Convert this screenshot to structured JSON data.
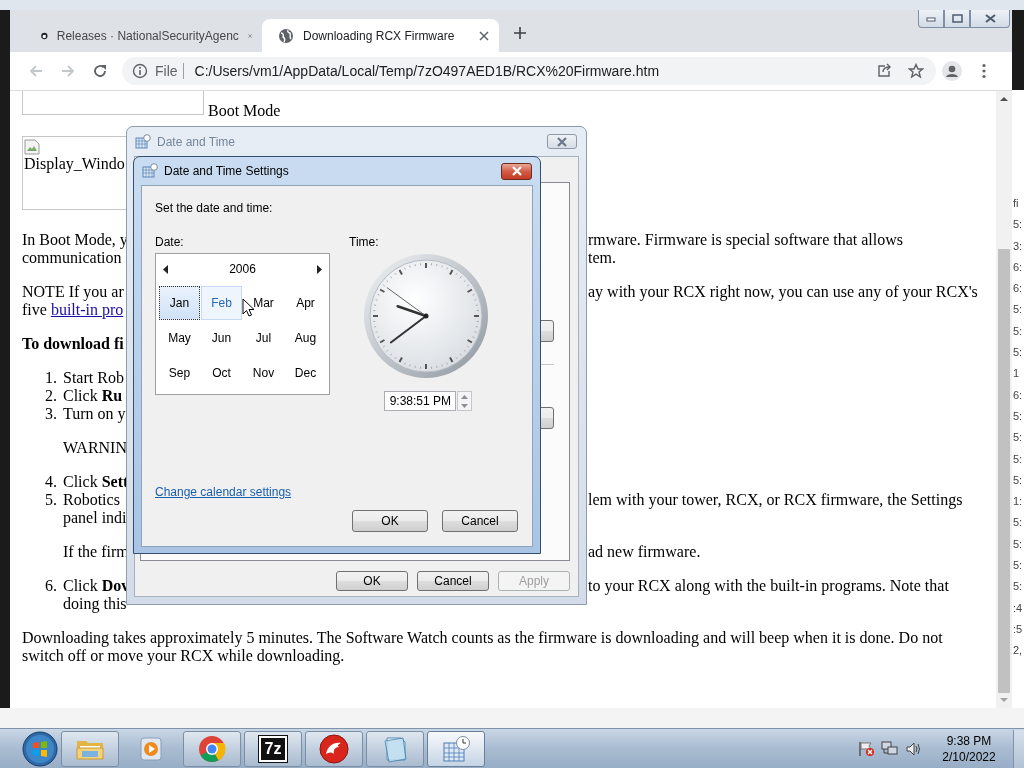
{
  "browser": {
    "tabs": [
      {
        "title": "Releases · NationalSecurityAgenc",
        "kind": "repository",
        "selected": false
      },
      {
        "title": "Downloading RCX Firmware",
        "kind": "local-page",
        "selected": true
      }
    ],
    "back": {
      "disabled": true
    },
    "forward": {
      "disabled": true
    },
    "address": {
      "scheme": "File",
      "url": "C:/Users/vm1/AppData/Local/Temp/7zO497AED1B/RCX%20Firmware.htm"
    }
  },
  "page": {
    "blocks": [
      {
        "kind": "figure",
        "caption": "Boot Mode"
      },
      {
        "kind": "broken-image",
        "alt": "Display_Windo"
      },
      {
        "kind": "paragraph",
        "lines": [
          {
            "left": "In Boot Mode, y",
            "right": "rmware. Firmware is special software that allows"
          },
          {
            "left": "communication",
            "right": "tem."
          }
        ]
      },
      {
        "kind": "paragraph",
        "lines": [
          {
            "left": "NOTE If you ar",
            "right": "ay with your RCX right now, you can use any of your RCX's"
          },
          {
            "left": "five ",
            "link": "built-in pro"
          }
        ]
      },
      {
        "kind": "heading",
        "text": "To download fi"
      },
      {
        "kind": "list",
        "items": [
          {
            "number": "1.",
            "lines": [
              {
                "left": "Start Rob"
              }
            ]
          },
          {
            "number": "2.",
            "lines": [
              {
                "left": "Click **Ru**"
              }
            ]
          },
          {
            "number": "3.",
            "lines": [
              {
                "left": "Turn on y"
              }
            ],
            "note": [
              {
                "left": "WARNIN"
              }
            ]
          },
          {
            "number": "4.",
            "lines": [
              {
                "left": "Click **Sett**"
              }
            ]
          },
          {
            "number": "5.",
            "lines": [
              {
                "left": "Robotics",
                "right": "lem with your tower, RCX, or RCX firmware, the Settings"
              },
              {
                "left": "panel indi"
              }
            ],
            "note": [
              {
                "left": "If the firm",
                "right": "ad new firmware."
              }
            ]
          },
          {
            "number": "6.",
            "lines": [
              {
                "left": "Click **Dov**",
                "right": "to your RCX along with the built-in programs. Note that"
              },
              {
                "left": "doing this"
              }
            ]
          }
        ]
      },
      {
        "kind": "paragraph",
        "lines": [
          {
            "text": "Downloading takes approximately 5 minutes. The Software Watch counts as the firmware is downloading and will beep when it is done. Do not"
          },
          {
            "text": "switch off or move your RCX while downloading."
          }
        ]
      }
    ]
  },
  "background_window": {
    "cells": [
      "fi",
      "5:",
      "3:",
      "6:",
      "6:",
      "5:",
      "5:",
      "5:",
      "1",
      "6:",
      "5:",
      "5:",
      "5:",
      "5:",
      "1:",
      "5:",
      "5:",
      "5:",
      "5:",
      ":4",
      ":5",
      "2,"
    ]
  },
  "date_time_dialog": {
    "title": "Date and Time",
    "active": false,
    "buttons": [
      {
        "label": "OK",
        "disabled": false
      },
      {
        "label": "Cancel",
        "disabled": false
      },
      {
        "label": "Apply",
        "disabled": true
      }
    ]
  },
  "settings_dialog": {
    "title": "Date and Time Settings",
    "active": true,
    "prompt": "Set the date and time:",
    "date_label": "Date:",
    "year": "2006",
    "months": [
      {
        "label": "Jan",
        "selected": true,
        "hovered": false
      },
      {
        "label": "Feb",
        "selected": false,
        "hovered": true
      },
      {
        "label": "Mar",
        "selected": false,
        "hovered": false
      },
      {
        "label": "Apr",
        "selected": false,
        "hovered": false
      },
      {
        "label": "May",
        "selected": false,
        "hovered": false
      },
      {
        "label": "Jun",
        "selected": false,
        "hovered": false
      },
      {
        "label": "Jul",
        "selected": false,
        "hovered": false
      },
      {
        "label": "Aug",
        "selected": false,
        "hovered": false
      },
      {
        "label": "Sep",
        "selected": false,
        "hovered": false
      },
      {
        "label": "Oct",
        "selected": false,
        "hovered": false
      },
      {
        "label": "Nov",
        "selected": false,
        "hovered": false
      },
      {
        "label": "Dec",
        "selected": false,
        "hovered": false
      }
    ],
    "time_label": "Time:",
    "time": "9:38:51 PM",
    "link": "Change calendar settings",
    "buttons": [
      "OK",
      "Cancel"
    ]
  },
  "taskbar": {
    "items": [
      {
        "kind": "folder",
        "running": true,
        "active": false
      },
      {
        "kind": "media",
        "running": false,
        "active": false
      },
      {
        "kind": "chrome",
        "running": true,
        "active": false
      },
      {
        "kind": "archiver",
        "label": "7z",
        "running": true,
        "active": false
      },
      {
        "kind": "dragon",
        "running": true,
        "active": false
      },
      {
        "kind": "notepad",
        "running": true,
        "active": false
      },
      {
        "kind": "datetime",
        "running": true,
        "active": true
      }
    ],
    "time": "9:38 PM",
    "date": "2/10/2022"
  }
}
